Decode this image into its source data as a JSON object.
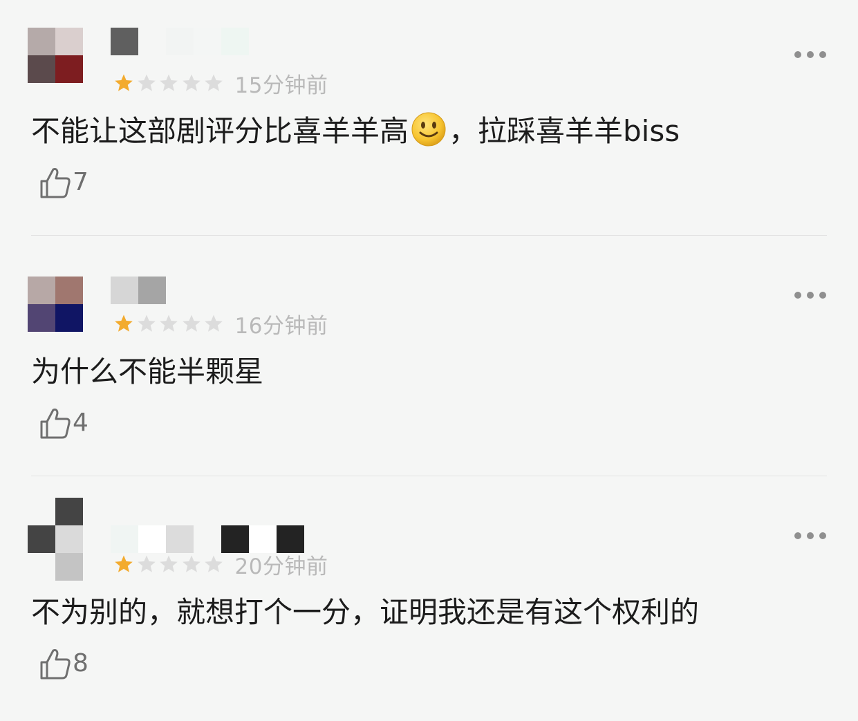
{
  "comments": [
    {
      "rating": 1,
      "time": "15分钟前",
      "text_before_emoji": "不能让这部剧评分比喜羊羊高",
      "text_after_emoji": "，拉踩喜羊羊biss",
      "emoji": "slightly-smiling-face-icon",
      "likes": "7",
      "avatar_colors": [
        "#b5aaa9",
        "#dacfce",
        "#5b4a4c",
        "#7d1d20"
      ],
      "name_colors": [
        "#5f5f5f",
        "#f5f6f5",
        "#f2f4f3",
        "#f4f6f5",
        "#eef6f2",
        "#f5f6f5"
      ]
    },
    {
      "rating": 1,
      "time": "16分钟前",
      "text_before_emoji": "为什么不能半颗星",
      "text_after_emoji": "",
      "emoji": "",
      "likes": "4",
      "avatar_colors": [
        "#b7a8a6",
        "#a0776f",
        "#524573",
        "#101564"
      ],
      "name_colors": [
        "#d6d6d6",
        "#a5a5a5"
      ]
    },
    {
      "rating": 1,
      "time": "20分钟前",
      "text_before_emoji": "不为别的，就想打个一分，证明我还是有这个权利的",
      "text_after_emoji": "",
      "emoji": "",
      "likes": "8",
      "avatar_colors": [
        "#f5f6f5",
        "#444444",
        "#444444",
        "#dadada",
        "#f5f6f5",
        "#c4c4c4"
      ],
      "name_colors": [
        "#f0f5f3",
        "#ffffff",
        "#dcdcdc",
        "#f5f6f5",
        "#232323",
        "#ffffff",
        "#232323"
      ]
    }
  ],
  "colors": {
    "star_filled": "#f3ab2e",
    "star_empty": "#dcdcdc",
    "time_text": "#b9b9b9",
    "like_icon": "#6f6f6f"
  },
  "icons": {
    "like": "thumbs-up-icon",
    "more": "more-dots-icon",
    "star": "star-icon"
  }
}
